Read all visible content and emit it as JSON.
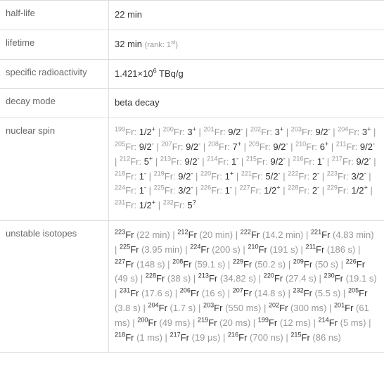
{
  "rows": {
    "half_life": {
      "label": "half-life",
      "value": "22 min"
    },
    "lifetime": {
      "label": "lifetime",
      "value": "32 min",
      "rank": "(rank: 1",
      "rank_sup": "st",
      "rank_close": ")"
    },
    "specific_radioactivity": {
      "label": "specific radioactivity",
      "prefix": "1.421×10",
      "exp": "6",
      "suffix": " TBq/g"
    },
    "decay_mode": {
      "label": "decay mode",
      "value": "beta decay"
    },
    "nuclear_spin": {
      "label": "nuclear spin",
      "items": [
        {
          "mass": "199",
          "sym": "Fr:",
          "spin": "1/2",
          "sign": "+"
        },
        {
          "mass": "200",
          "sym": "Fr:",
          "spin": "3",
          "sign": "+"
        },
        {
          "mass": "201",
          "sym": "Fr:",
          "spin": "9/2",
          "sign": "-"
        },
        {
          "mass": "202",
          "sym": "Fr:",
          "spin": "3",
          "sign": "+"
        },
        {
          "mass": "203",
          "sym": "Fr:",
          "spin": "9/2",
          "sign": "-"
        },
        {
          "mass": "204",
          "sym": "Fr:",
          "spin": "3",
          "sign": "+"
        },
        {
          "mass": "205",
          "sym": "Fr:",
          "spin": "9/2",
          "sign": "-"
        },
        {
          "mass": "207",
          "sym": "Fr:",
          "spin": "9/2",
          "sign": "-"
        },
        {
          "mass": "208",
          "sym": "Fr:",
          "spin": "7",
          "sign": "+"
        },
        {
          "mass": "209",
          "sym": "Fr:",
          "spin": "9/2",
          "sign": "-"
        },
        {
          "mass": "210",
          "sym": "Fr:",
          "spin": "6",
          "sign": "+"
        },
        {
          "mass": "211",
          "sym": "Fr:",
          "spin": "9/2",
          "sign": "-"
        },
        {
          "mass": "212",
          "sym": "Fr:",
          "spin": "5",
          "sign": "+"
        },
        {
          "mass": "213",
          "sym": "Fr:",
          "spin": "9/2",
          "sign": "-"
        },
        {
          "mass": "214",
          "sym": "Fr:",
          "spin": "1",
          "sign": "-"
        },
        {
          "mass": "215",
          "sym": "Fr:",
          "spin": "9/2",
          "sign": "-"
        },
        {
          "mass": "216",
          "sym": "Fr:",
          "spin": "1",
          "sign": "-"
        },
        {
          "mass": "217",
          "sym": "Fr:",
          "spin": "9/2",
          "sign": "-"
        },
        {
          "mass": "218",
          "sym": "Fr:",
          "spin": "1",
          "sign": "-"
        },
        {
          "mass": "219",
          "sym": "Fr:",
          "spin": "9/2",
          "sign": "-"
        },
        {
          "mass": "220",
          "sym": "Fr:",
          "spin": "1",
          "sign": "+"
        },
        {
          "mass": "221",
          "sym": "Fr:",
          "spin": "5/2",
          "sign": "-"
        },
        {
          "mass": "222",
          "sym": "Fr:",
          "spin": "2",
          "sign": "-"
        },
        {
          "mass": "223",
          "sym": "Fr:",
          "spin": "3/2",
          "sign": "-"
        },
        {
          "mass": "224",
          "sym": "Fr:",
          "spin": "1",
          "sign": "-"
        },
        {
          "mass": "225",
          "sym": "Fr:",
          "spin": "3/2",
          "sign": "-"
        },
        {
          "mass": "226",
          "sym": "Fr:",
          "spin": "1",
          "sign": "-"
        },
        {
          "mass": "227",
          "sym": "Fr:",
          "spin": "1/2",
          "sign": "+"
        },
        {
          "mass": "228",
          "sym": "Fr:",
          "spin": "2",
          "sign": "-"
        },
        {
          "mass": "229",
          "sym": "Fr:",
          "spin": "1/2",
          "sign": "+"
        },
        {
          "mass": "231",
          "sym": "Fr:",
          "spin": "1/2",
          "sign": "+"
        },
        {
          "mass": "232",
          "sym": "Fr:",
          "spin": "5",
          "sign": "?"
        }
      ]
    },
    "unstable_isotopes": {
      "label": "unstable isotopes",
      "items": [
        {
          "mass": "223",
          "sym": "Fr",
          "time": "(22 min)"
        },
        {
          "mass": "212",
          "sym": "Fr",
          "time": "(20 min)"
        },
        {
          "mass": "222",
          "sym": "Fr",
          "time": "(14.2 min)"
        },
        {
          "mass": "221",
          "sym": "Fr",
          "time": "(4.83 min)"
        },
        {
          "mass": "225",
          "sym": "Fr",
          "time": "(3.95 min)"
        },
        {
          "mass": "224",
          "sym": "Fr",
          "time": "(200 s)"
        },
        {
          "mass": "210",
          "sym": "Fr",
          "time": "(191 s)"
        },
        {
          "mass": "211",
          "sym": "Fr",
          "time": "(186 s)"
        },
        {
          "mass": "227",
          "sym": "Fr",
          "time": "(148 s)"
        },
        {
          "mass": "208",
          "sym": "Fr",
          "time": "(59.1 s)"
        },
        {
          "mass": "229",
          "sym": "Fr",
          "time": "(50.2 s)"
        },
        {
          "mass": "209",
          "sym": "Fr",
          "time": "(50 s)"
        },
        {
          "mass": "226",
          "sym": "Fr",
          "time": "(49 s)"
        },
        {
          "mass": "228",
          "sym": "Fr",
          "time": "(38 s)"
        },
        {
          "mass": "213",
          "sym": "Fr",
          "time": "(34.82 s)"
        },
        {
          "mass": "220",
          "sym": "Fr",
          "time": "(27.4 s)"
        },
        {
          "mass": "230",
          "sym": "Fr",
          "time": "(19.1 s)"
        },
        {
          "mass": "231",
          "sym": "Fr",
          "time": "(17.6 s)"
        },
        {
          "mass": "206",
          "sym": "Fr",
          "time": "(16 s)"
        },
        {
          "mass": "207",
          "sym": "Fr",
          "time": "(14.8 s)"
        },
        {
          "mass": "232",
          "sym": "Fr",
          "time": "(5.5 s)"
        },
        {
          "mass": "205",
          "sym": "Fr",
          "time": "(3.8 s)"
        },
        {
          "mass": "204",
          "sym": "Fr",
          "time": "(1.7 s)"
        },
        {
          "mass": "203",
          "sym": "Fr",
          "time": "(550 ms)"
        },
        {
          "mass": "202",
          "sym": "Fr",
          "time": "(300 ms)"
        },
        {
          "mass": "201",
          "sym": "Fr",
          "time": "(61 ms)"
        },
        {
          "mass": "200",
          "sym": "Fr",
          "time": "(49 ms)"
        },
        {
          "mass": "219",
          "sym": "Fr",
          "time": "(20 ms)"
        },
        {
          "mass": "199",
          "sym": "Fr",
          "time": "(12 ms)"
        },
        {
          "mass": "214",
          "sym": "Fr",
          "time": "(5 ms)"
        },
        {
          "mass": "218",
          "sym": "Fr",
          "time": "(1 ms)"
        },
        {
          "mass": "217",
          "sym": "Fr",
          "time": "(19 μs)"
        },
        {
          "mass": "216",
          "sym": "Fr",
          "time": "(700 ns)"
        },
        {
          "mass": "215",
          "sym": "Fr",
          "time": "(86 ns)"
        }
      ]
    }
  },
  "sep": " | "
}
